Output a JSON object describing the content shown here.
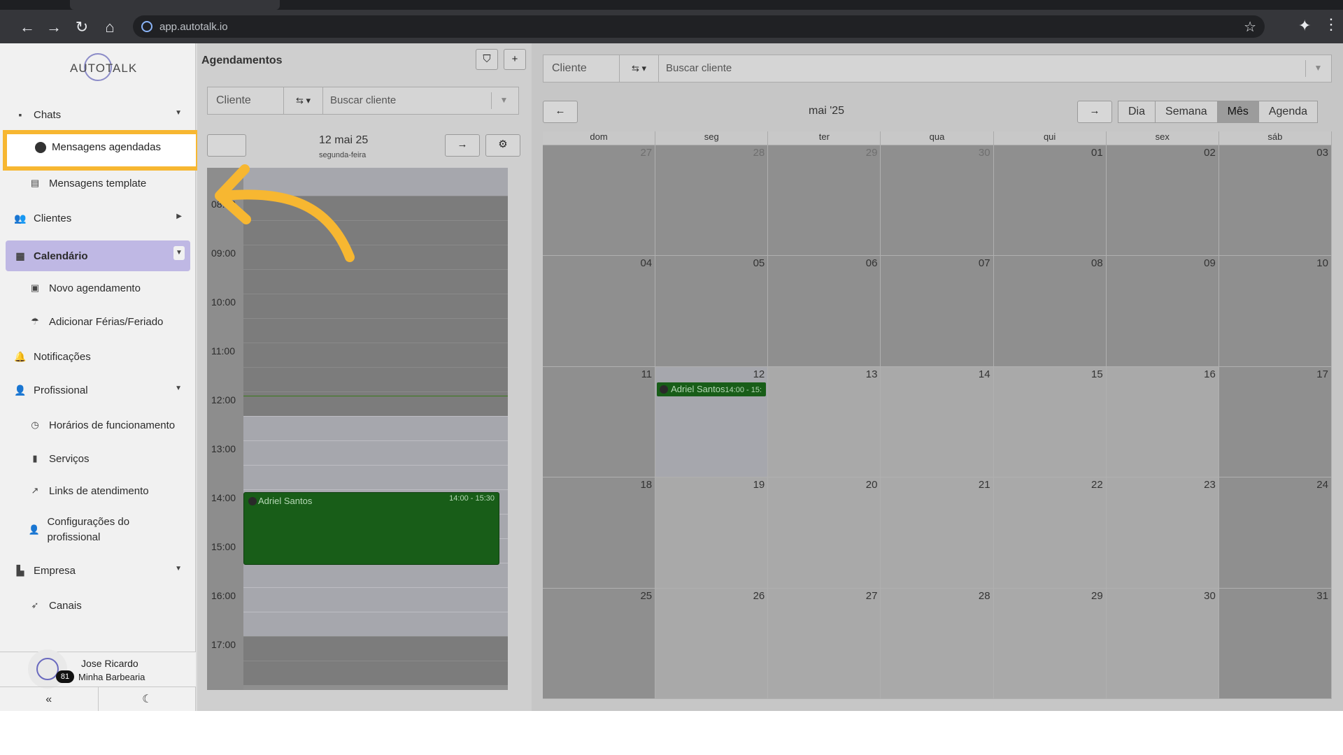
{
  "browser": {
    "url": "app.autotalk.io"
  },
  "logo": {
    "text": "AUTOTALK"
  },
  "sidebar": {
    "items": [
      {
        "label": "Chats"
      },
      {
        "label": "Mensagens agendadas"
      },
      {
        "label": "Mensagens template"
      },
      {
        "label": "Clientes"
      },
      {
        "label": "Calendário"
      },
      {
        "label": "Novo agendamento"
      },
      {
        "label": "Adicionar Férias/Feriado"
      },
      {
        "label": "Notificações"
      },
      {
        "label": "Profissional"
      },
      {
        "label": "Horários de funcionamento"
      },
      {
        "label": "Serviços"
      },
      {
        "label": "Links de atendimento"
      },
      {
        "label": "Configurações do profissional"
      },
      {
        "label": "Empresa"
      },
      {
        "label": "Canais"
      }
    ],
    "user": {
      "name": "Jose Ricardo",
      "company": "Minha Barbearia",
      "badge": "81"
    }
  },
  "schedule": {
    "title": "Agendamentos",
    "filter": {
      "select": "Cliente",
      "placeholder": "Buscar cliente"
    },
    "date": "12 mai 25",
    "weekday": "segunda-feira",
    "hours": [
      "08:00",
      "09:00",
      "10:00",
      "11:00",
      "12:00",
      "13:00",
      "14:00",
      "15:00",
      "16:00",
      "17:00"
    ],
    "event": {
      "name": "Adriel Santos",
      "time": "14:00 - 15:30"
    }
  },
  "calendar": {
    "filter": {
      "select": "Cliente",
      "placeholder": "Buscar cliente"
    },
    "month_title": "mai '25",
    "views": [
      "Dia",
      "Semana",
      "Mês",
      "Agenda"
    ],
    "active_view": "Mês",
    "weekdays": [
      "dom",
      "seg",
      "ter",
      "qua",
      "qui",
      "sex",
      "sáb"
    ],
    "weeks": [
      [
        "27",
        "28",
        "29",
        "30",
        "01",
        "02",
        "03"
      ],
      [
        "04",
        "05",
        "06",
        "07",
        "08",
        "09",
        "10"
      ],
      [
        "11",
        "12",
        "13",
        "14",
        "15",
        "16",
        "17"
      ],
      [
        "18",
        "19",
        "20",
        "21",
        "22",
        "23",
        "24"
      ],
      [
        "25",
        "26",
        "27",
        "28",
        "29",
        "30",
        "31"
      ]
    ],
    "event": {
      "name": "Adriel Santos",
      "time": "14:00 - 15:"
    }
  },
  "colors": {
    "highlight": "#f7b731",
    "event_green": "#185d18",
    "active_nav": "#bfb8e4"
  }
}
